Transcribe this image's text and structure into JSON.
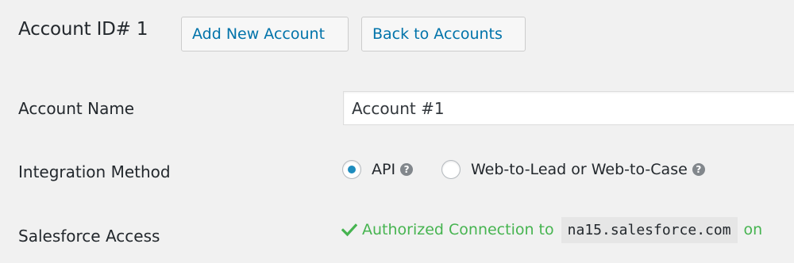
{
  "header": {
    "title": "Account ID# 1",
    "add_button": "Add New Account",
    "back_button": "Back to Accounts"
  },
  "form": {
    "account_name": {
      "label": "Account Name",
      "value": "Account #1"
    },
    "integration_method": {
      "label": "Integration Method",
      "options": [
        {
          "label": "API",
          "selected": true,
          "help_icon": "question-circle-icon"
        },
        {
          "label": "Web-to-Lead or Web-to-Case",
          "selected": false,
          "help_icon": "question-circle-icon"
        }
      ]
    },
    "salesforce_access": {
      "label": "Salesforce Access",
      "status_icon": "checkmark-icon",
      "status_text": "Authorized Connection to",
      "host": "na15.salesforce.com",
      "trailing_text": "on"
    }
  },
  "colors": {
    "background": "#f1f1f1",
    "link_blue": "#0073aa",
    "radio_selected": "#1e8cbe",
    "success_green": "#46b450",
    "help_icon_gray": "#82878c"
  }
}
